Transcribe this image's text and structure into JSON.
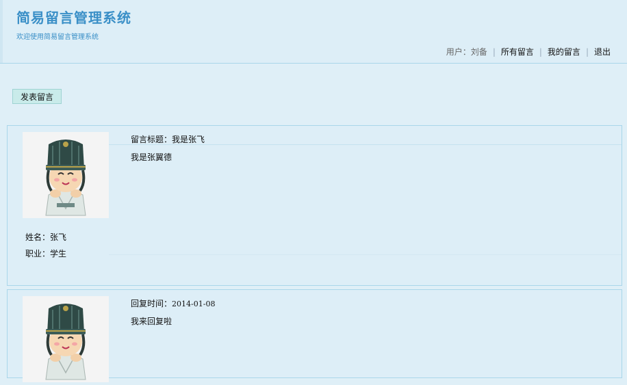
{
  "app": {
    "title": "简易留言管理系统",
    "subtitle": "欢迎使用简易留言管理系统"
  },
  "nav": {
    "user_label": "用户：",
    "user_name": "刘备",
    "separator": "|",
    "all_messages": "所有留言",
    "my_messages": "我的留言",
    "logout": "退出"
  },
  "actions": {
    "post_message": "发表留言"
  },
  "message": {
    "title": "留言标题：我是张飞",
    "content": "我是张翼德",
    "author_name": "姓名：张飞",
    "author_job": "职业：学生"
  },
  "reply": {
    "time_label": "回复时间：",
    "time_value": "2014-01-08",
    "content": "我来回复啦"
  },
  "colors": {
    "page_bg": "#dfeff7",
    "accent": "#3a8fc7",
    "border": "#a9d6ea",
    "button_bg": "#c9ebea"
  },
  "icons": {
    "avatar": "cartoon-scholar-avatar"
  }
}
